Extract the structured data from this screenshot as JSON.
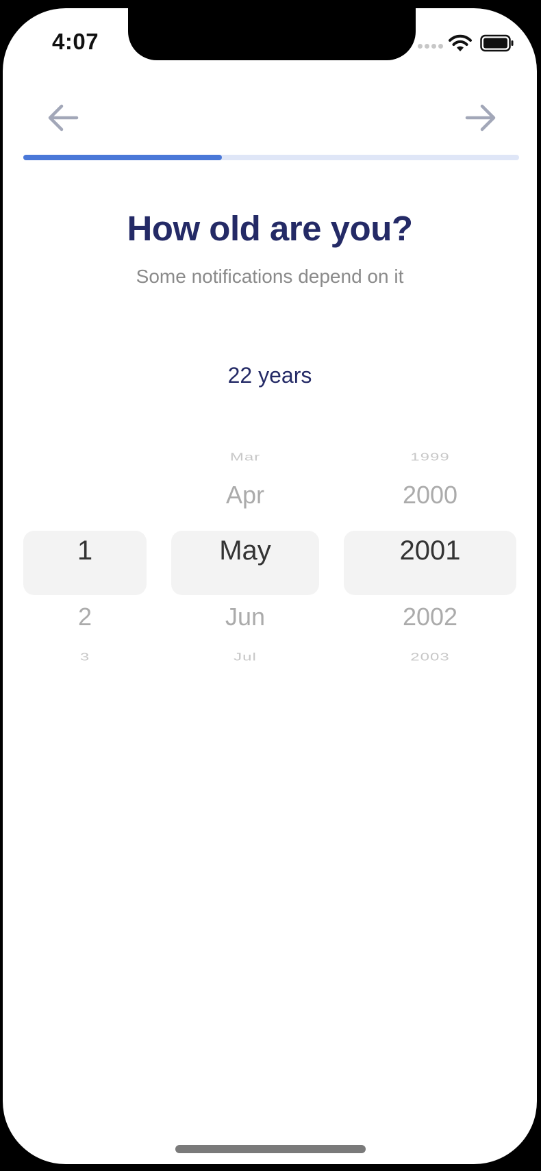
{
  "status_bar": {
    "time": "4:07"
  },
  "nav": {
    "back_icon": "arrow-left-icon",
    "next_icon": "arrow-right-icon",
    "icon_color": "#a2a7b8"
  },
  "progress": {
    "fraction": 0.4,
    "fill_color": "#4a78d8",
    "track_color": "#dfe6f7"
  },
  "header": {
    "title": "How old are you?",
    "subtitle": "Some notifications depend on it"
  },
  "age": {
    "label": "22 years"
  },
  "picker": {
    "day": {
      "items": [
        "",
        "",
        "1",
        "2",
        "3"
      ],
      "selected": "1"
    },
    "month": {
      "items": [
        "Mar",
        "Apr",
        "May",
        "Jun",
        "Jul"
      ],
      "selected": "May"
    },
    "year": {
      "items": [
        "1999",
        "2000",
        "2001",
        "2002",
        "2003"
      ],
      "selected": "2001"
    }
  },
  "colors": {
    "title": "#242a66",
    "subtitle": "#8a8a8a",
    "picker_highlight": "#f3f3f3"
  }
}
